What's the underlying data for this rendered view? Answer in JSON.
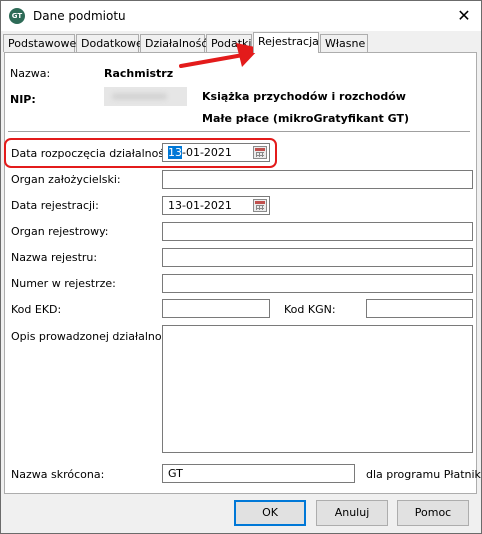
{
  "window": {
    "title": "Dane podmiotu",
    "app_icon_text": "GT",
    "close_glyph": "✕"
  },
  "tabs": [
    "Podstawowe",
    "Dodatkowe",
    "Działalność",
    "Podatki",
    "Rejestracja",
    "Własne"
  ],
  "active_tab": "Rejestracja",
  "header": {
    "nazwa_label": "Nazwa:",
    "nazwa_value": "Rachmistrz",
    "nip_label": "NIP:",
    "book_type": "Książka przychodów i rozchodów",
    "payer_type": "Małe płace (mikroGratyfikant GT)"
  },
  "form": {
    "data_rozpoczecia_label": "Data rozpoczęcia działalności:",
    "data_rozpoczecia_selected": "13",
    "data_rozpoczecia_rest": "-01-2021",
    "organ_zalozycielski_label": "Organ założycielski:",
    "data_rejestracji_label": "Data rejestracji:",
    "data_rejestracji_value": "13-01-2021",
    "organ_rejestrowy_label": "Organ rejestrowy:",
    "nazwa_rejestru_label": "Nazwa rejestru:",
    "numer_w_rejestrze_label": "Numer w rejestrze:",
    "kod_ekd_label": "Kod EKD:",
    "kod_kgn_label": "Kod KGN:",
    "opis_label": "Opis prowadzonej działalności:",
    "nazwa_skrocona_label": "Nazwa skrócona:",
    "nazwa_skrocona_value": "GT",
    "platnik_note": "dla programu Płatnik"
  },
  "buttons": {
    "ok": "OK",
    "cancel": "Anuluj",
    "help": "Pomoc"
  },
  "annotation": {
    "highlight_color": "#e31b1b"
  }
}
